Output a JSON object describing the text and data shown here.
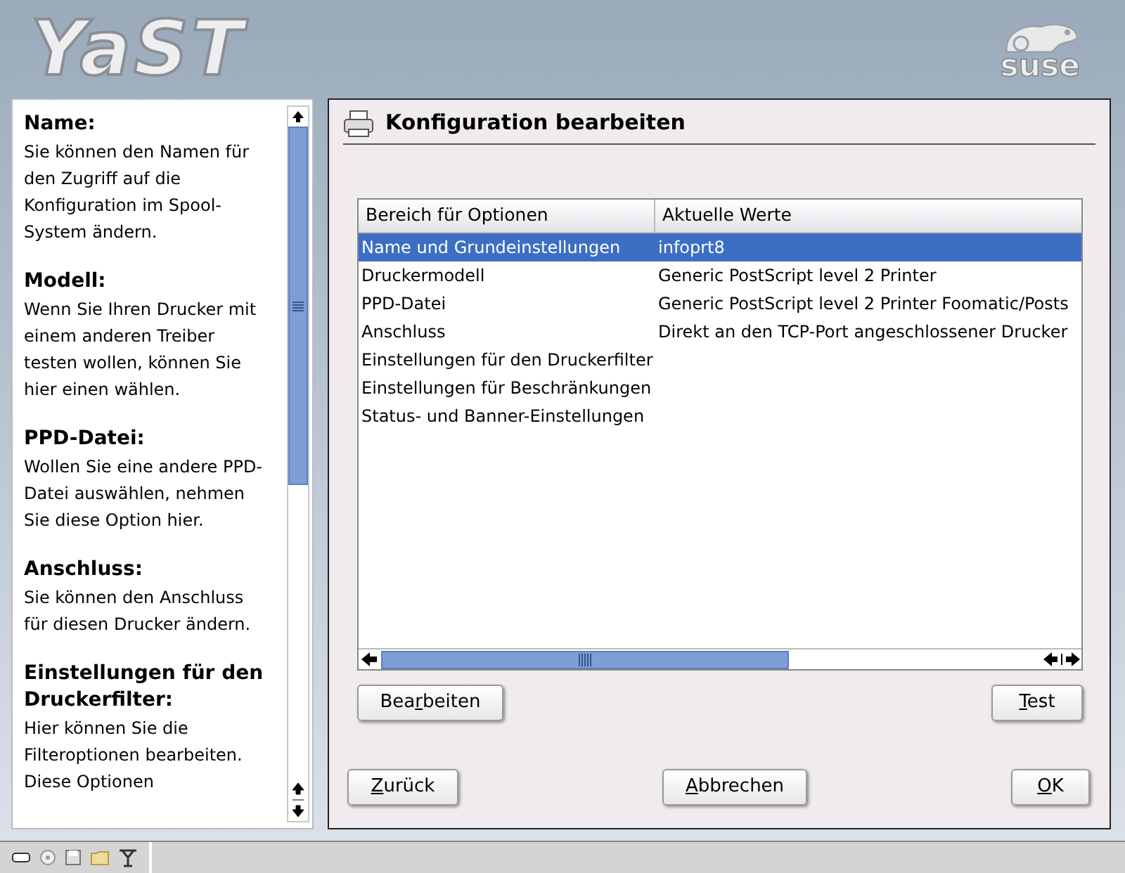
{
  "header": {
    "logo": "YaST",
    "brand": "suse"
  },
  "help": {
    "sections": [
      {
        "title": "Name:",
        "text": "Sie können den Namen für den Zugriff auf die Konfiguration im Spool-System ändern."
      },
      {
        "title": "Modell:",
        "text": "Wenn Sie Ihren Drucker mit einem anderen Treiber testen wollen, können Sie hier einen wählen."
      },
      {
        "title": "PPD-Datei:",
        "text": "Wollen Sie eine andere PPD-Datei auswählen, nehmen Sie diese Option hier."
      },
      {
        "title": "Anschluss:",
        "text": "Sie können den Anschluss für diesen Drucker ändern."
      },
      {
        "title": "Einstellungen für den Druckerfilter:",
        "text": "Hier können Sie die Filteroptionen bearbeiten. Diese Optionen"
      }
    ]
  },
  "dialog": {
    "title": "Konfiguration bearbeiten",
    "table": {
      "columns": [
        "Bereich für Optionen",
        "Aktuelle Werte"
      ],
      "rows": [
        {
          "cells": [
            "Name und Grundeinstellungen",
            "infoprt8"
          ],
          "selected": true
        },
        {
          "cells": [
            "Druckermodell",
            "Generic  PostScript level 2 Printer"
          ],
          "selected": false
        },
        {
          "cells": [
            "PPD-Datei",
            "Generic PostScript level 2 Printer Foomatic/Posts"
          ],
          "selected": false
        },
        {
          "cells": [
            "Anschluss",
            "Direkt an den TCP-Port angeschlossener Drucker"
          ],
          "selected": false
        },
        {
          "cells": [
            "Einstellungen für den Druckerfilter"
          ],
          "selected": false
        },
        {
          "cells": [
            "Einstellungen für Beschränkungen"
          ],
          "selected": false
        },
        {
          "cells": [
            "Status- und Banner-Einstellungen"
          ],
          "selected": false
        }
      ]
    },
    "table_buttons": [
      {
        "before": "Bea",
        "key": "r",
        "after": "beiten"
      },
      {
        "key": "T",
        "after": "est"
      }
    ],
    "buttons": [
      {
        "key": "Z",
        "after": "urück"
      },
      {
        "key": "A",
        "after": "bbrechen"
      },
      {
        "key": "O",
        "after": "K"
      }
    ]
  }
}
